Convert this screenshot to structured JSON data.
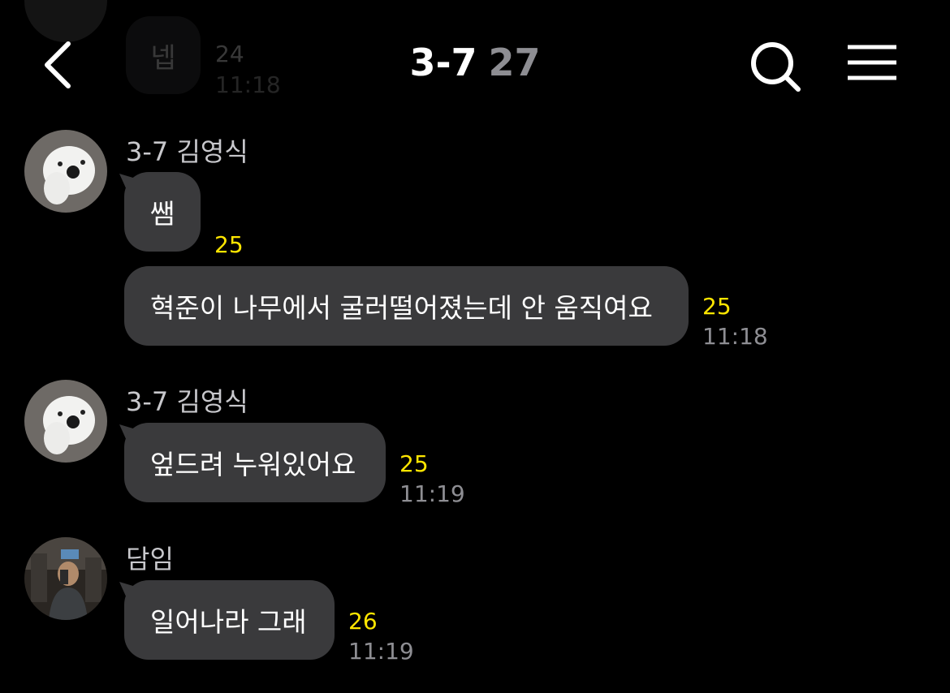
{
  "header": {
    "title": "3-7",
    "member_count": "27"
  },
  "faded_message": {
    "text": "넵",
    "unread": "24",
    "time": "11:18"
  },
  "messages": [
    {
      "sender": "3-7 김영식",
      "bubbles": [
        {
          "text": "쌤",
          "unread": "25",
          "time": ""
        },
        {
          "text": "혁준이 나무에서 굴러떨어졌는데 안 움직여요",
          "unread": "25",
          "time": "11:18"
        }
      ]
    },
    {
      "sender": "3-7 김영식",
      "bubbles": [
        {
          "text": "엎드려 누워있어요",
          "unread": "25",
          "time": "11:19"
        }
      ]
    },
    {
      "sender": "담임",
      "bubbles": [
        {
          "text": "일어나라 그래",
          "unread": "26",
          "time": "11:19"
        }
      ]
    }
  ],
  "icons": {
    "back": "chevron-left-icon",
    "search": "search-icon",
    "menu": "menu-icon"
  },
  "colors": {
    "background": "#000000",
    "bubble": "#3a3a3c",
    "unread": "#ffe600",
    "time": "#8e8e93"
  }
}
